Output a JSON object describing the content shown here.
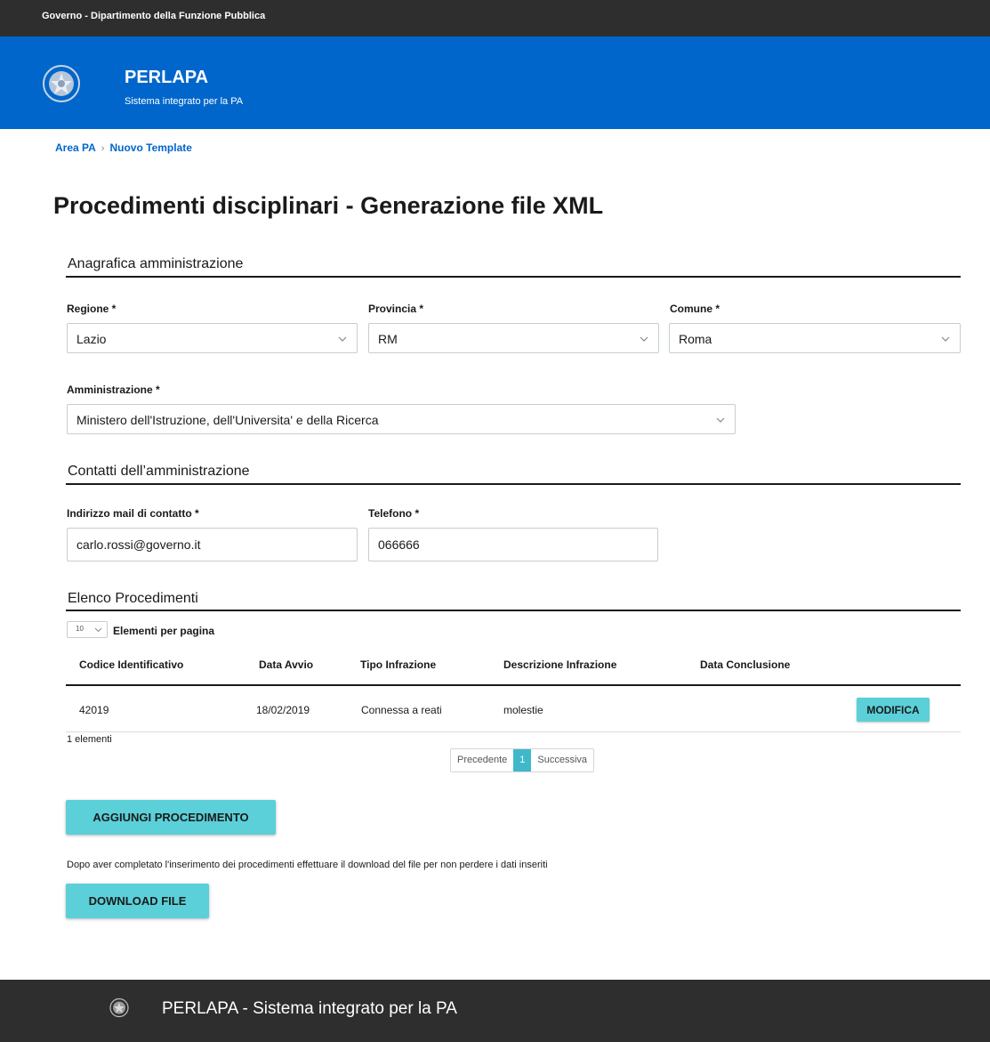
{
  "gov_bar": {
    "text": "Governo - Dipartimento della Funzione Pubblica"
  },
  "header": {
    "emblem_icon": "italian-republic-emblem-icon",
    "title": "PERLAPA",
    "subtitle": "Sistema integrato per la PA"
  },
  "breadcrumb": {
    "items": [
      "Area PA",
      "Nuovo Template"
    ],
    "separator": "›"
  },
  "page": {
    "title": "Procedimenti disciplinari - Generazione file XML"
  },
  "anagrafica": {
    "title": "Anagrafica amministrazione",
    "regione": {
      "label": "Regione *",
      "value": "Lazio"
    },
    "provincia": {
      "label": "Provincia *",
      "value": "RM"
    },
    "comune": {
      "label": "Comune *",
      "value": "Roma"
    },
    "amministrazione": {
      "label": "Amministrazione *",
      "value": "Ministero dell'Istruzione, dell'Universita' e della Ricerca"
    }
  },
  "contatti": {
    "title": "Contatti dell’amministrazione",
    "email": {
      "label": "Indirizzo mail di contatto *",
      "value": "carlo.rossi@governo.it"
    },
    "telefono": {
      "label": "Telefono *",
      "value": "066666"
    }
  },
  "procedimenti": {
    "title": "Elenco Procedimenti",
    "per_page": {
      "value": "10",
      "label": "Elementi per pagina"
    },
    "columns": [
      "Codice Identificativo",
      "Data Avvio",
      "Tipo Infrazione",
      "Descrizione Infrazione",
      "Data Conclusione"
    ],
    "rows": [
      {
        "codice": "42019",
        "data_avvio": "18/02/2019",
        "tipo": "Connessa a reati",
        "descrizione": "molestie",
        "data_conclusione": "",
        "action": "MODIFICA"
      }
    ],
    "count_text": "1 elementi",
    "pagination": {
      "prev": "Precedente",
      "current": "1",
      "next": "Successiva"
    }
  },
  "actions": {
    "add_label": "AGGIUNGI PROCEDIMENTO",
    "note": "Dopo aver completato l'inserimento dei procedimenti effettuare il download del file per non perdere i dati inseriti",
    "download_label": "DOWNLOAD FILE"
  },
  "footer": {
    "text": "PERLAPA - Sistema integrato per la PA",
    "emblem_icon": "italian-republic-emblem-icon"
  },
  "colors": {
    "header_blue": "#0066cc",
    "dark_bar": "#2e2e2e",
    "button_teal": "#5bd0d9",
    "pager_active": "#3fb9c9",
    "link_blue": "#0066cc"
  }
}
